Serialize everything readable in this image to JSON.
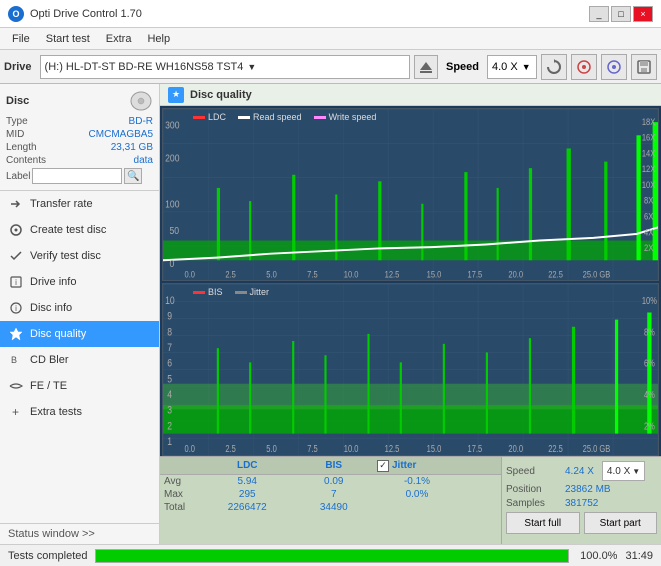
{
  "app": {
    "title": "Opti Drive Control 1.70",
    "icon": "O"
  },
  "titlebar": {
    "controls": [
      "_",
      "□",
      "×"
    ]
  },
  "menubar": {
    "items": [
      "File",
      "Start test",
      "Extra",
      "Help"
    ]
  },
  "toolbar": {
    "drive_label": "Drive",
    "drive_value": "(H:)  HL-DT-ST BD-RE  WH16NS58 TST4",
    "speed_label": "Speed",
    "speed_value": "4.0 X"
  },
  "sidebar": {
    "disc_title": "Disc",
    "disc_fields": [
      {
        "label": "Type",
        "value": "BD-R"
      },
      {
        "label": "MID",
        "value": "CMCMAGBA5"
      },
      {
        "label": "Length",
        "value": "23,31 GB"
      },
      {
        "label": "Contents",
        "value": "data"
      }
    ],
    "disc_label_field": "Label",
    "nav_items": [
      {
        "label": "Transfer rate",
        "icon": "→",
        "active": false
      },
      {
        "label": "Create test disc",
        "icon": "◉",
        "active": false
      },
      {
        "label": "Verify test disc",
        "icon": "✓",
        "active": false
      },
      {
        "label": "Drive info",
        "icon": "i",
        "active": false
      },
      {
        "label": "Disc info",
        "icon": "📀",
        "active": false
      },
      {
        "label": "Disc quality",
        "icon": "★",
        "active": true
      },
      {
        "label": "CD Bler",
        "icon": "B",
        "active": false
      },
      {
        "label": "FE / TE",
        "icon": "~",
        "active": false
      },
      {
        "label": "Extra tests",
        "icon": "+",
        "active": false
      }
    ],
    "status_window": "Status window >>"
  },
  "content": {
    "title": "Disc quality",
    "chart1": {
      "legend": [
        {
          "label": "LDC",
          "color": "#ff4444"
        },
        {
          "label": "Read speed",
          "color": "#ffffff"
        },
        {
          "label": "Write speed",
          "color": "#ff88ff"
        }
      ],
      "y_labels_left": [
        "300",
        "200",
        "100",
        "50",
        "0"
      ],
      "y_labels_right": [
        "18X",
        "16X",
        "14X",
        "12X",
        "10X",
        "8X",
        "6X",
        "4X",
        "2X"
      ],
      "x_labels": [
        "0.0",
        "2.5",
        "5.0",
        "7.5",
        "10.0",
        "12.5",
        "15.0",
        "17.5",
        "20.0",
        "22.5",
        "25.0 GB"
      ]
    },
    "chart2": {
      "legend": [
        {
          "label": "BIS",
          "color": "#ff4444"
        },
        {
          "label": "Jitter",
          "color": "#888888"
        }
      ],
      "y_labels_left": [
        "10",
        "9",
        "8",
        "7",
        "6",
        "5",
        "4",
        "3",
        "2",
        "1"
      ],
      "y_labels_right": [
        "10%",
        "8%",
        "6%",
        "4%",
        "2%"
      ],
      "x_labels": [
        "0.0",
        "2.5",
        "5.0",
        "7.5",
        "10.0",
        "12.5",
        "15.0",
        "17.5",
        "20.0",
        "22.5",
        "25.0 GB"
      ]
    },
    "stats": {
      "columns": [
        "LDC",
        "BIS"
      ],
      "jitter_label": "Jitter",
      "speed_label": "Speed",
      "speed_value": "4.24 X",
      "speed_select": "4.0 X",
      "rows": [
        {
          "label": "Avg",
          "ldc": "5.94",
          "bis": "0.09",
          "jitter": "-0.1%"
        },
        {
          "label": "Max",
          "ldc": "295",
          "bis": "7",
          "jitter": "0.0%"
        },
        {
          "label": "Total",
          "ldc": "2266472",
          "bis": "34490",
          "jitter": ""
        }
      ],
      "position_label": "Position",
      "position_value": "23862 MB",
      "samples_label": "Samples",
      "samples_value": "381752",
      "btn_start_full": "Start full",
      "btn_start_part": "Start part"
    }
  },
  "statusbar": {
    "text": "Tests completed",
    "progress": 100,
    "percent": "100.0%",
    "time": "31:49"
  }
}
